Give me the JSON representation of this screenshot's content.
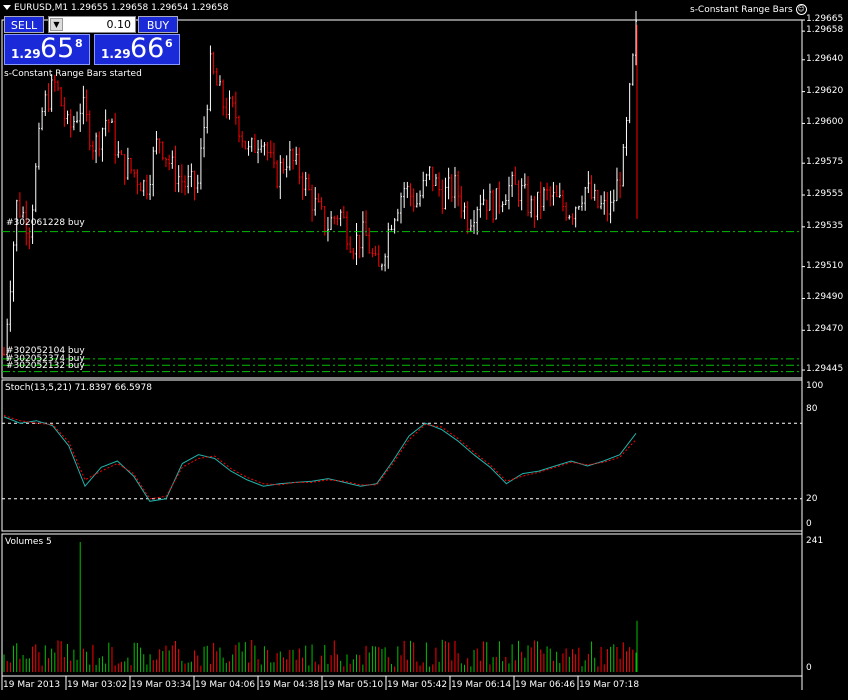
{
  "header": {
    "symbol_info": "EURUSD,M1  1.29655 1.29658 1.29654 1.29658",
    "expert_name": "s-Constant Range Bars",
    "status_message": "s-Constant Range Bars started"
  },
  "trade_panel": {
    "sell_label": "SELL",
    "buy_label": "BUY",
    "lot_value": "0.10",
    "sell_price": {
      "prefix": "1.29",
      "big": "65",
      "sup": "8"
    },
    "buy_price": {
      "prefix": "1.29",
      "big": "66",
      "sup": "6"
    }
  },
  "price_axis": {
    "ticks": [
      "1.29665",
      "1.29658",
      "1.29640",
      "1.29620",
      "1.29600",
      "1.29575",
      "1.29555",
      "1.29535",
      "1.29510",
      "1.29490",
      "1.29470",
      "1.29445"
    ],
    "range": [
      1.2944,
      1.29665
    ]
  },
  "orders": [
    {
      "label": "#302061228 buy",
      "price": 1.29532
    },
    {
      "label": "#302052104 buy",
      "price": 1.29452
    },
    {
      "label": "#302052374 buy",
      "price": 1.29448
    },
    {
      "label": "#302052132 buy",
      "price": 1.29444
    }
  ],
  "stochastic": {
    "title": "Stoch(13,5,21) 71.8397 66.5978",
    "ticks": [
      "100",
      "80",
      "20",
      "0"
    ],
    "levels": [
      80,
      20
    ]
  },
  "volumes": {
    "title": "Volumes 5",
    "ticks": [
      "241",
      "0"
    ],
    "max": 241
  },
  "time_axis": {
    "labels": [
      "19 Mar 2013",
      "19 Mar 03:02",
      "19 Mar 03:34",
      "19 Mar 04:06",
      "19 Mar 04:38",
      "19 Mar 05:10",
      "19 Mar 05:42",
      "19 Mar 06:14",
      "19 Mar 06:46",
      "19 Mar 07:18"
    ]
  },
  "colors": {
    "bull": "#ffffff",
    "bear": "#ff0000",
    "stoch_main": "#20b2aa",
    "stoch_signal": "#ff0000",
    "volume_up": "#00c000",
    "volume_down": "#ff0000",
    "order_line": "#00c000",
    "grid": "#ffffff"
  },
  "chart_data": {
    "type": "line",
    "title": "EURUSD,M1",
    "close_series": {
      "name": "",
      "values": [
        1.29455,
        1.2955,
        1.29535,
        1.2961,
        1.29625,
        1.29595,
        1.29612,
        1.29585,
        1.29605,
        1.29575,
        1.2957,
        1.2956,
        1.29592,
        1.29572,
        1.29562,
        1.2956,
        1.29635,
        1.29612,
        1.29605,
        1.2958,
        1.29595,
        1.29565,
        1.2958,
        1.29568,
        1.2955,
        1.29535,
        1.29545,
        1.29525,
        1.2953,
        1.29505,
        1.2954,
        1.2956,
        1.2955,
        1.29568,
        1.29555,
        1.2956,
        1.2954,
        1.29555,
        1.29548,
        1.2956,
        1.29558,
        1.29545,
        1.29555,
        1.2955,
        1.29545,
        1.2956,
        1.29548,
        1.29545,
        1.29575,
        1.29658
      ]
    },
    "stochastic": {
      "main": [
        85,
        80,
        82,
        78,
        62,
        30,
        45,
        50,
        38,
        18,
        20,
        48,
        55,
        52,
        42,
        35,
        30,
        32,
        33,
        34,
        36,
        33,
        30,
        32,
        50,
        70,
        80,
        75,
        66,
        55,
        45,
        32,
        40,
        42,
        46,
        50,
        46,
        50,
        55,
        72
      ],
      "signal": [
        86,
        82,
        80,
        79,
        65,
        35,
        42,
        48,
        40,
        20,
        22,
        45,
        52,
        54,
        44,
        37,
        32,
        31,
        33,
        33,
        35,
        34,
        31,
        31,
        48,
        67,
        79,
        77,
        68,
        57,
        47,
        34,
        38,
        41,
        45,
        49,
        47,
        49,
        53,
        67
      ]
    },
    "ylim": [
      1.2944,
      1.29665
    ]
  }
}
